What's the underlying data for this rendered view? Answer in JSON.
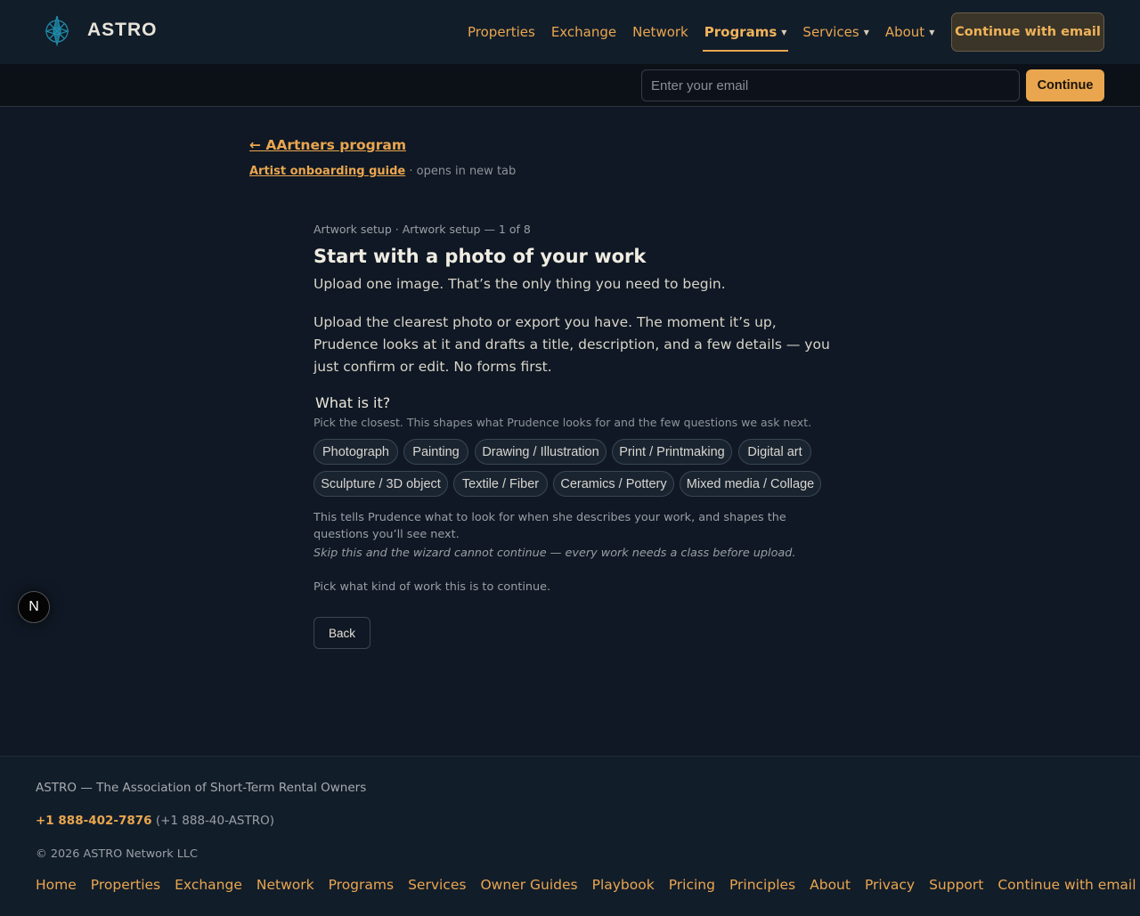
{
  "brand": {
    "name": "ASTRO",
    "logo_icon": "compass-star-icon",
    "logo_color": "#1f8aa8"
  },
  "nav": {
    "items": [
      {
        "label": "Properties",
        "dropdown": false
      },
      {
        "label": "Exchange",
        "dropdown": false
      },
      {
        "label": "Network",
        "dropdown": false
      },
      {
        "label": "Programs",
        "dropdown": true,
        "active": true
      },
      {
        "label": "Services",
        "dropdown": true
      },
      {
        "label": "About",
        "dropdown": true
      }
    ],
    "cta_label": "Continue with email",
    "caret_glyph": "▼"
  },
  "email_bar": {
    "placeholder": "Enter your email",
    "button_label": "Continue"
  },
  "back": {
    "label": "← AArtners program"
  },
  "guide": {
    "link_label": "Artist onboarding guide",
    "note": " · opens in new tab"
  },
  "wizard": {
    "step_label": "Artwork setup · Artwork setup — 1 of 8",
    "title": "Start with a photo of your work",
    "subtitle": "Upload one image. That’s the only thing you need to begin.",
    "description": "Upload the clearest photo or export you have. The moment it’s up, Prudence looks at it and drafts a title, description, and a few details — you just confirm or edit. No forms first.",
    "question": "What is it?",
    "question_hint": "Pick the closest. This shapes what Prudence looks for and the few questions we ask next.",
    "options": [
      "Photograph",
      "Painting",
      "Drawing / Illustration",
      "Print / Printmaking",
      "Digital art",
      "Sculpture / 3D object",
      "Textile / Fiber",
      "Ceramics / Pottery",
      "Mixed media / Collage"
    ],
    "note_primary": "This tells Prudence what to look for when she describes your work, and shapes the questions you’ll see next.",
    "note_warning": "Skip this and the wizard cannot continue — every work needs a class before upload.",
    "note_action": "Pick what kind of work this is to continue.",
    "back_label": "Back"
  },
  "badge": {
    "letter": "N"
  },
  "footer": {
    "tagline": "ASTRO — The Association of Short-Term Rental Owners",
    "phone": "+1 888-402-7876",
    "phone_alt": " (+1 888-40-ASTRO)",
    "copyright": "© 2026 ASTRO Network LLC",
    "links": [
      "Home",
      "Properties",
      "Exchange",
      "Network",
      "Programs",
      "Services",
      "Owner Guides",
      "Playbook",
      "Pricing",
      "Principles",
      "About",
      "Privacy",
      "Support",
      "Continue with email"
    ]
  },
  "colors": {
    "accent": "#e9a64f",
    "background": "#0f1824",
    "header": "#121d2a"
  }
}
